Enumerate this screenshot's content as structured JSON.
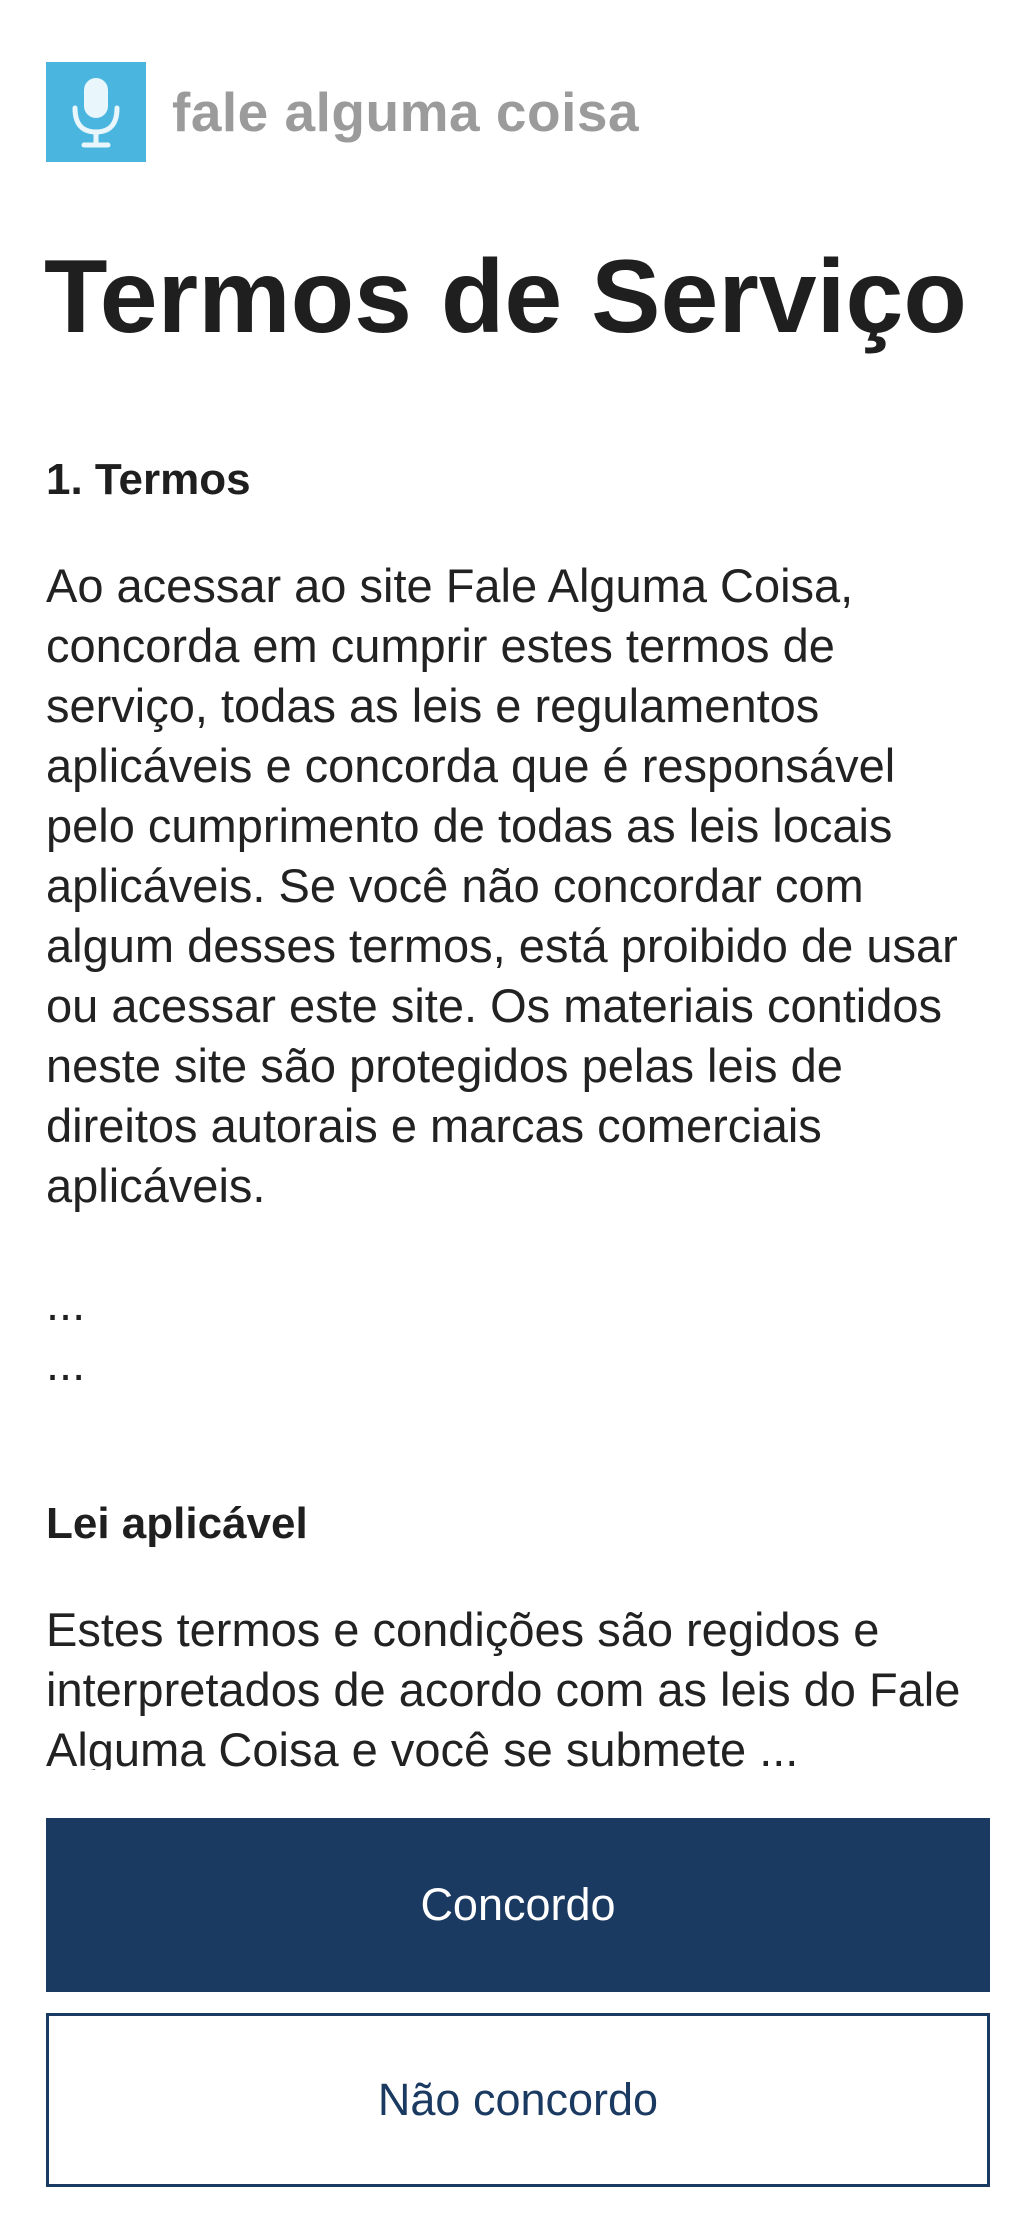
{
  "header": {
    "logo_icon": "microphone-icon",
    "logo_color": "#4ab6df",
    "app_name": "fale alguma coisa"
  },
  "page": {
    "title": "Termos de Serviço"
  },
  "sections": [
    {
      "heading": "1. Termos",
      "body": "Ao acessar ao site Fale Alguma Coisa, concorda em cumprir estes termos de serviço, todas as leis e regulamentos aplicáveis e concorda que é responsável pelo cumprimento de todas as leis locais aplicáveis. Se você não concordar com algum desses termos, está proibido de usar ou acessar este site. Os materiais contidos neste site são protegidos pelas leis de direitos autorais e marcas comerciais aplicáveis."
    },
    {
      "heading": "Lei aplicável",
      "body": "Estes termos e condições são regidos e interpretados de acordo com as leis do Fale Alguma Coisa e você se submete ..."
    }
  ],
  "ellipsis": [
    "...",
    "..."
  ],
  "actions": {
    "agree_label": "Concordo",
    "disagree_label": "Não concordo",
    "primary_color": "#1b3a61"
  }
}
